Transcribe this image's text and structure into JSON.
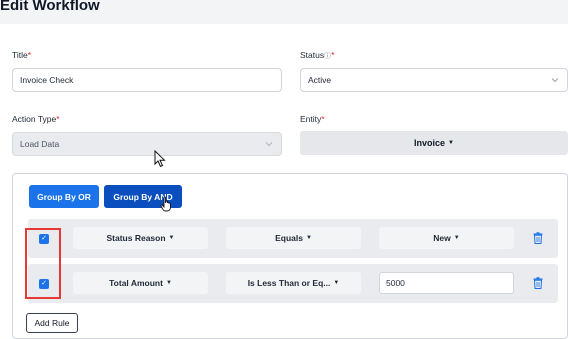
{
  "page": {
    "title": "Edit Workflow"
  },
  "form": {
    "title_label": "Title",
    "title_value": "Invoice Check",
    "status_label": "Status",
    "status_value": "Active",
    "action_type_label": "Action Type",
    "action_type_value": "Load Data",
    "entity_label": "Entity",
    "entity_value": "Invoice",
    "required_mark": "*"
  },
  "rules": {
    "group_by_or": "Group By OR",
    "group_by_and": "Group By AND",
    "rows": [
      {
        "field": "Status Reason",
        "operator": "Equals",
        "value": "New",
        "checked": true
      },
      {
        "field": "Total Amount",
        "operator": "Is Less Than or Eq...",
        "value": "5000",
        "checked": true
      }
    ],
    "add_rule": "Add Rule"
  },
  "colors": {
    "primary": "#1a73e8",
    "primary_active": "#0b4fbf",
    "highlight": "#e53935",
    "required": "#dc2626"
  },
  "icons": [
    "info-icon",
    "chevron-down-icon",
    "caret-down-icon",
    "checkbox-checked-icon",
    "trash-icon",
    "pointer-cursor-icon",
    "hand-cursor-icon"
  ]
}
